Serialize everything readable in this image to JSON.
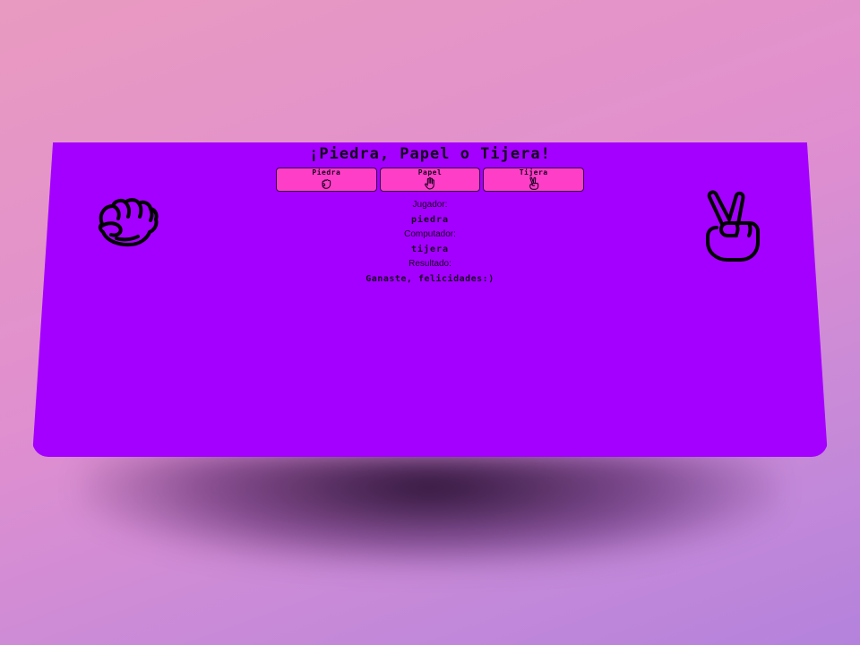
{
  "title": "¡Piedra, Papel o Tijera!",
  "choices": [
    {
      "label": "Piedra",
      "icon": "fist-icon"
    },
    {
      "label": "Papel",
      "icon": "open-hand-icon"
    },
    {
      "label": "Tijera",
      "icon": "peace-hand-icon"
    }
  ],
  "player": {
    "label": "Jugador:",
    "value": "piedra"
  },
  "computer": {
    "label": "Computador:",
    "value": "tijera"
  },
  "result": {
    "label": "Resultado:",
    "value": "Ganaste, felicidades:)"
  },
  "player_display_icon": "fist-icon",
  "computer_display_icon": "peace-hand-icon",
  "colors": {
    "card": "#a400ff",
    "button": "#ff3ec8",
    "text": "#1a0022"
  }
}
